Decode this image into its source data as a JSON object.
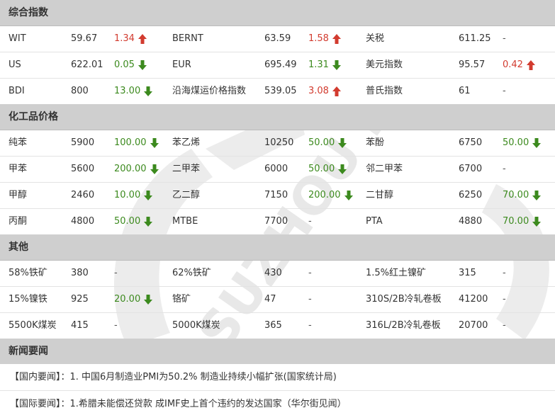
{
  "sections": {
    "composite": {
      "title": "综合指数",
      "rows": [
        [
          {
            "n": "WIT",
            "v": "59.67",
            "c": "1.34",
            "d": "up"
          },
          {
            "n": "BERNT",
            "v": "63.59",
            "c": "1.58",
            "d": "up"
          },
          {
            "n": "关税",
            "v": "611.25",
            "c": "-",
            "d": "flat"
          }
        ],
        [
          {
            "n": "US",
            "v": "622.01",
            "c": "0.05",
            "d": "down"
          },
          {
            "n": "EUR",
            "v": "695.49",
            "c": "1.31",
            "d": "down"
          },
          {
            "n": "美元指数",
            "v": "95.57",
            "c": "0.42",
            "d": "up"
          }
        ],
        [
          {
            "n": "BDI",
            "v": "800",
            "c": "13.00",
            "d": "down"
          },
          {
            "n": "沿海煤运价格指数",
            "v": "539.05",
            "c": "3.08",
            "d": "up"
          },
          {
            "n": "普氏指数",
            "v": "61",
            "c": "-",
            "d": "flat"
          }
        ]
      ]
    },
    "chemical": {
      "title": "化工品价格",
      "rows": [
        [
          {
            "n": "纯苯",
            "v": "5900",
            "c": "100.00",
            "d": "down"
          },
          {
            "n": "苯乙烯",
            "v": "10250",
            "c": "50.00",
            "d": "down"
          },
          {
            "n": "苯酚",
            "v": "6750",
            "c": "50.00",
            "d": "down"
          }
        ],
        [
          {
            "n": "甲苯",
            "v": "5600",
            "c": "200.00",
            "d": "down"
          },
          {
            "n": "二甲苯",
            "v": "6000",
            "c": "50.00",
            "d": "down"
          },
          {
            "n": "邻二甲苯",
            "v": "6700",
            "c": "-",
            "d": "flat"
          }
        ],
        [
          {
            "n": "甲醇",
            "v": "2460",
            "c": "10.00",
            "d": "down"
          },
          {
            "n": "乙二醇",
            "v": "7150",
            "c": "200.00",
            "d": "down"
          },
          {
            "n": "二甘醇",
            "v": "6250",
            "c": "70.00",
            "d": "down"
          }
        ],
        [
          {
            "n": "丙酮",
            "v": "4800",
            "c": "50.00",
            "d": "down"
          },
          {
            "n": "MTBE",
            "v": "7700",
            "c": "-",
            "d": "flat"
          },
          {
            "n": "PTA",
            "v": "4880",
            "c": "70.00",
            "d": "down"
          }
        ]
      ]
    },
    "other": {
      "title": "其他",
      "rows": [
        [
          {
            "n": "58%铁矿",
            "v": "380",
            "c": "-",
            "d": "flat"
          },
          {
            "n": "62%铁矿",
            "v": "430",
            "c": "-",
            "d": "flat"
          },
          {
            "n": "1.5%红土镍矿",
            "v": "315",
            "c": "-",
            "d": "flat"
          }
        ],
        [
          {
            "n": "15%镍铁",
            "v": "925",
            "c": "20.00",
            "d": "down"
          },
          {
            "n": "铬矿",
            "v": "47",
            "c": "-",
            "d": "flat"
          },
          {
            "n": "310S/2B冷轧卷板",
            "v": "41200",
            "c": "-",
            "d": "flat"
          }
        ],
        [
          {
            "n": "5500K煤炭",
            "v": "415",
            "c": "-",
            "d": "flat"
          },
          {
            "n": "5000K煤炭",
            "v": "365",
            "c": "-",
            "d": "flat"
          },
          {
            "n": "316L/2B冷轧卷板",
            "v": "20700",
            "c": "-",
            "d": "flat"
          }
        ]
      ]
    }
  },
  "news": {
    "title": "新闻要闻",
    "items": [
      "【国内要闻】：1. 中国6月制造业PMI为50.2% 制造业持续小幅扩张(国家统计局)",
      "【国际要闻】：1.希腊未能偿还贷款 成IMF史上首个违约的发达国家（华尔街见闻）"
    ]
  },
  "colors": {
    "up": "#d23b2f",
    "down": "#3c8a1e",
    "header_bg": "#cfcfcf"
  },
  "watermark_text": "SUZHOU PORT"
}
